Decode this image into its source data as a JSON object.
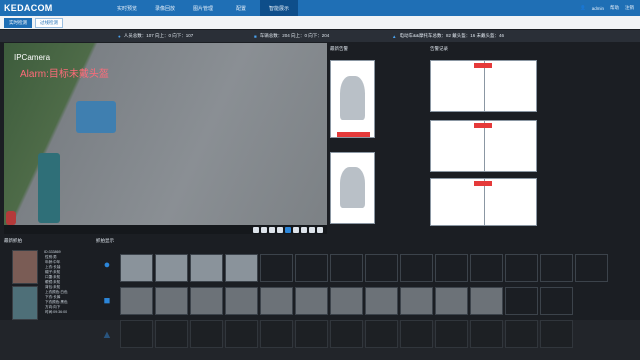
{
  "brand": "KEDACOM",
  "nav": [
    "实时预览",
    "录像回放",
    "图片管理",
    "配置",
    "智能展示"
  ],
  "nav_active": 4,
  "user": {
    "name": "admin",
    "help": "帮助",
    "logout": "注销"
  },
  "subtabs": [
    "实时检测",
    "过线检测"
  ],
  "stats": {
    "people": "人员总数：107  向上：0  向下：107",
    "vehicles": "车辆总数：204  向上：0  向下：204",
    "ebikes": "电动车&&摩托车总数：82  戴头盔：16  未戴头盔：46"
  },
  "video": {
    "channel": "IPCamera",
    "alarm": "Alarm:目标未戴头盔"
  },
  "panels": {
    "latest_alarm": "最新告警",
    "alarm_record": "告警记录",
    "latest_capture": "最新抓拍",
    "capture_display": "抓拍显示"
  },
  "capture_info": "ID:333869\n 性别:男\n 年龄:中年\n 上衣:长袖\n 帽子:未知\n 口罩:未知\n 眼镜:未知\n 背包:未知\n 上衣颜色:白色\n 下衣:长裤\n 下衣颜色:黑色\n 方向:向下\n 时间:09:36:00",
  "colors": {
    "topbar": "#1f6fb5",
    "alarm_tag": "#e53a3a",
    "accent": "#2c86d9"
  },
  "icons": [
    "person-icon",
    "car-icon",
    "motorbike-icon"
  ]
}
